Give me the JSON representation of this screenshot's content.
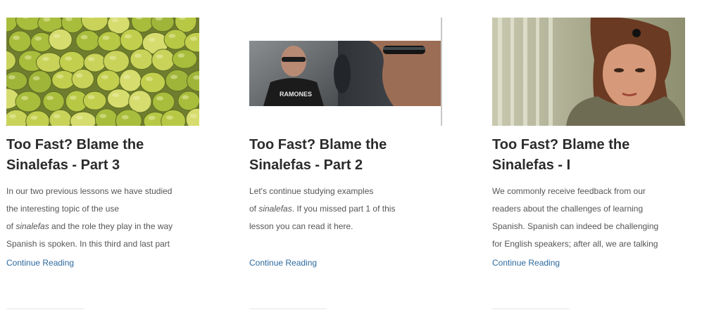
{
  "posts": [
    {
      "title_line1": "Too Fast? Blame the",
      "title_line2": "Sinalefas - Part 3",
      "excerpt": {
        "l1": "In our two previous lessons we have studied",
        "l2": "the interesting topic of the use",
        "l3_pre": "of ",
        "l3_em": "sinalefas",
        "l3_post": " and the role they play in the way",
        "l4": "Spanish is spoken. In this third and last part"
      },
      "link": "Continue Reading"
    },
    {
      "title_line1": "Too Fast? Blame the",
      "title_line2": "Sinalefas - Part 2",
      "excerpt": {
        "l1": "Let's continue studying examples",
        "l2_pre": "of ",
        "l2_em": "sinalefas",
        "l2_post": ". If you missed part 1 of this",
        "l3": "lesson you can read it here."
      },
      "link": "Continue Reading"
    },
    {
      "title_line1": "Too Fast? Blame the",
      "title_line2": "Sinalefas - I",
      "excerpt": {
        "l1": "We commonly receive feedback from our",
        "l2": "readers about the challenges of learning",
        "l3": "Spanish. Spanish can indeed be challenging",
        "l4": "for English speakers; after all, we are talking"
      },
      "link": "Continue Reading"
    }
  ],
  "image_subjects": {
    "post1": "pile-of-limes",
    "post2": "man-in-sunglasses-ramones-shirt",
    "post3": "woman-portrait"
  },
  "image_text": {
    "shirt": "RAMONES"
  }
}
